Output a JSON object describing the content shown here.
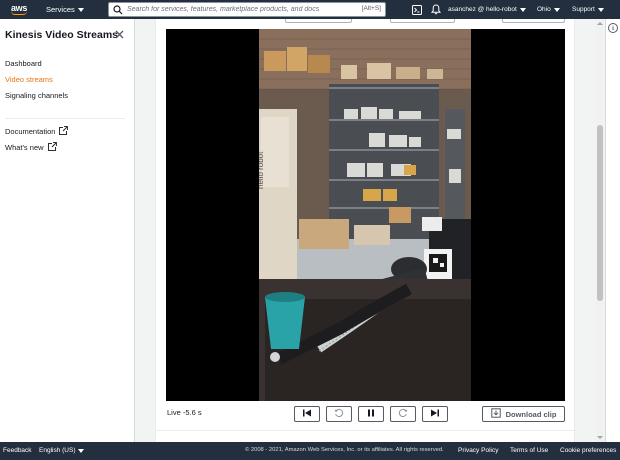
{
  "topnav": {
    "logo_text": "aws",
    "services_label": "Services",
    "search_placeholder": "Search for services, features, marketplace products, and docs",
    "search_shortcut": "[Alt+S]",
    "user_label": "asanchez @ hello-robot",
    "region_label": "Ohio",
    "support_label": "Support"
  },
  "sidebar": {
    "title": "Kinesis Video Streams",
    "items": [
      {
        "label": "Dashboard",
        "active": false
      },
      {
        "label": "Video streams",
        "active": true
      },
      {
        "label": "Signaling channels",
        "active": false
      }
    ],
    "links": [
      {
        "label": "Documentation",
        "icon": "external-link-icon"
      },
      {
        "label": "What's new",
        "icon": "external-link-icon"
      }
    ]
  },
  "player": {
    "live_status": "Live -5.6 s",
    "controls": [
      "skip-back-icon",
      "rewind-icon",
      "pause-icon",
      "forward-icon",
      "skip-forward-icon"
    ],
    "download_label": "Download clip"
  },
  "footer": {
    "feedback": "Feedback",
    "language": "English (US)",
    "copyright": "© 2008 - 2021, Amazon Web Services, Inc. or its affiliates. All rights reserved.",
    "privacy": "Privacy Policy",
    "terms": "Terms of Use",
    "cookies": "Cookie preferences"
  },
  "colors": {
    "nav_bg": "#232f3e",
    "accent": "#ec7211",
    "aws_orange": "#ff9900"
  }
}
